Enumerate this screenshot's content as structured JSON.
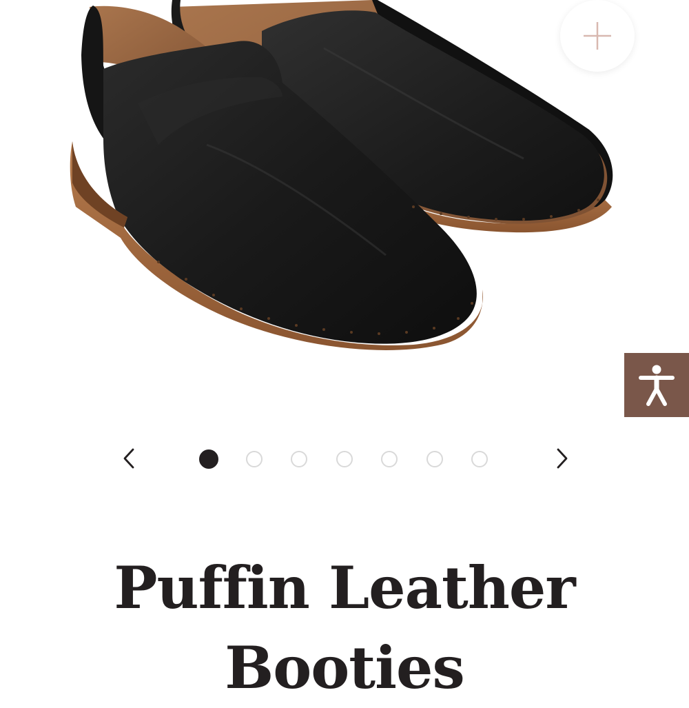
{
  "product": {
    "title": "Puffin Leather Booties",
    "image_alt": "Black leather slip-on booties with tan stacked sole"
  },
  "gallery": {
    "total_images": 7,
    "active_index": 0,
    "prev_label": "‹",
    "next_label": "›"
  },
  "zoom_button": {
    "icon": "plus-icon"
  },
  "accessibility_button": {
    "icon": "accessibility-person-icon"
  },
  "colors": {
    "text": "#231f20",
    "accessibility_bg": "#7a574a",
    "zoom_icon": "#d8b8b0",
    "dot_inactive": "#d9d9d9"
  }
}
